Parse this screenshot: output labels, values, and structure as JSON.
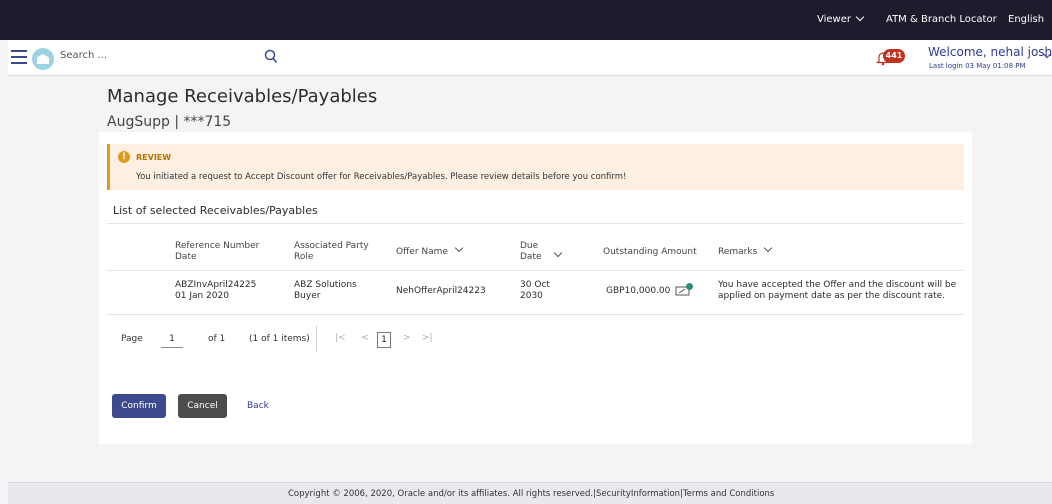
{
  "topbar": {
    "viewer": "Viewer",
    "atm": "ATM & Branch Locator",
    "language": "English"
  },
  "header": {
    "search_placeholder": "Search ...",
    "notification_count": "441",
    "welcome": "Welcome, nehal joshi",
    "last_login": "Last login 03 May 01:08 PM"
  },
  "page": {
    "title": "Manage Receivables/Payables",
    "account": "AugSupp | ***715"
  },
  "review": {
    "title": "REVIEW",
    "message": "You initiated a request to Accept Discount offer for Receivables/Payables. Please review details before you confirm!"
  },
  "list": {
    "title": "List of selected Receivables/Payables",
    "columns": {
      "ref_line1": "Reference Number",
      "ref_line2": "Date",
      "party_line1": "Associated Party",
      "party_line2": "Role",
      "offer": "Offer Name",
      "due_line1": "Due",
      "due_line2": "Date",
      "outstanding": "Outstanding Amount",
      "remarks": "Remarks"
    },
    "rows": [
      {
        "ref": "ABZInvApril24225",
        "date": "01 Jan 2020",
        "party": "ABZ Solutions",
        "role": "Buyer",
        "offer": "NehOfferApril24223",
        "due_line1": "30 Oct",
        "due_line2": "2030",
        "outstanding": "GBP10,000.00",
        "remarks_line1": "You have accepted the Offer and the discount will be",
        "remarks_line2": "applied on payment date as per the discount rate."
      }
    ]
  },
  "pagination": {
    "page_label": "Page",
    "page_value": "1",
    "of_label": "of 1",
    "items_label": "(1 of 1 items)",
    "first": "|<",
    "prev": "<",
    "current": "1",
    "next": ">",
    "last": ">|"
  },
  "actions": {
    "confirm": "Confirm",
    "cancel": "Cancel",
    "back": "Back"
  },
  "footer": {
    "text": "Copyright © 2006, 2020, Oracle and/or its affiliates. All rights reserved.|SecurityInformation|Terms and Conditions"
  },
  "colors": {
    "primary": "#3d4a8e",
    "review_accent": "#e09b1e",
    "badge": "#c0321f",
    "topbar": "#1c1c2c"
  }
}
